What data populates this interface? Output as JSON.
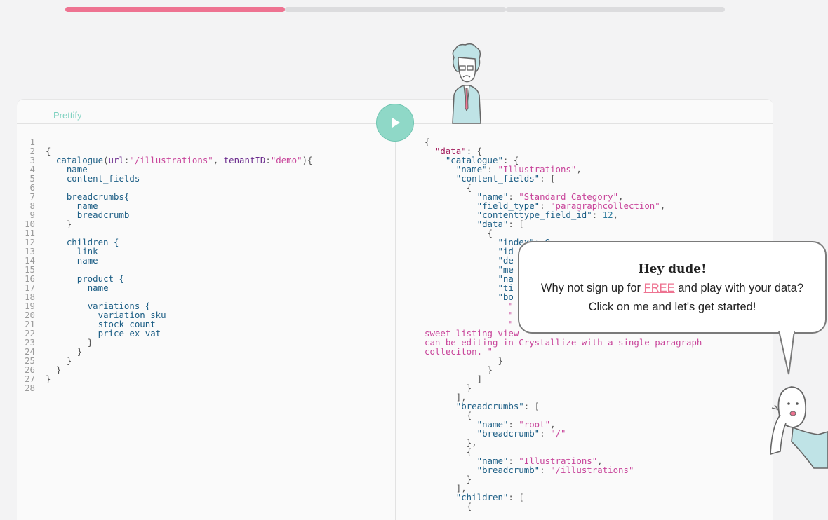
{
  "progress": {
    "value": 0.333,
    "segments": 3
  },
  "toolbar": {
    "prettify_label": "Prettify",
    "run_icon": "play-icon"
  },
  "editor": {
    "line_numbers": [
      "1",
      "2",
      "3",
      "4",
      "5",
      "6",
      "7",
      "8",
      "9",
      "10",
      "11",
      "12",
      "13",
      "14",
      "15",
      "16",
      "17",
      "18",
      "19",
      "20",
      "21",
      "22",
      "23",
      "24",
      "25",
      "26",
      "27",
      "28"
    ],
    "query": {
      "l2": "{",
      "l3_field": "catalogue",
      "l3_open": "(",
      "l3_arg1": "url",
      "l3_colon1": ":",
      "l3_val1": "\"/illustrations\"",
      "l3_comma": ", ",
      "l3_arg2": "tenantID",
      "l3_colon2": ":",
      "l3_val2": "\"demo\"",
      "l3_close": "){",
      "l4": "name",
      "l5": "content_fields",
      "l7": "breadcrumbs{",
      "l8": "name",
      "l9": "breadcrumb",
      "l10": "}",
      "l12": "children {",
      "l13": "link",
      "l14": "name",
      "l16": "product {",
      "l17": "name",
      "l19": "variations {",
      "l20": "variation_sku",
      "l21": "stock_count",
      "l22": "price_ex_vat",
      "l23": "}",
      "l24": "}",
      "l25": "}",
      "l26": "}",
      "l27": "}"
    }
  },
  "result": {
    "r1": "{",
    "r2_key": "\"data\"",
    "r2_rest": ": {",
    "r3_key": "\"catalogue\"",
    "r3_rest": ": {",
    "r4_key": "\"name\"",
    "r4_sep": ": ",
    "r4_val": "\"Illustrations\"",
    "r4_end": ",",
    "r5_key": "\"content_fields\"",
    "r5_rest": ": [",
    "r6": "{",
    "r7_key": "\"name\"",
    "r7_sep": ": ",
    "r7_val": "\"Standard Category\"",
    "r7_end": ",",
    "r8_key": "\"field_type\"",
    "r8_sep": ": ",
    "r8_val": "\"paragraphcollection\"",
    "r8_end": ",",
    "r9_key": "\"contenttype_field_id\"",
    "r9_sep": ": ",
    "r9_val": "12",
    "r9_end": ",",
    "r10_key": "\"data\"",
    "r10_rest": ": [",
    "r11": "{",
    "r12": "\"index\": 0",
    "r13": "\"id",
    "r14": "\"de",
    "r15": "\"me",
    "r16": "\"na",
    "r17": "\"ti",
    "r18": "\"bo",
    "r19": "\"",
    "r20": "\"",
    "r21": "\"",
    "r22": "sweet listing view",
    "r23": "can be editing in Crystallize with a single paragraph",
    "r24": "colleciton. \"",
    "r25": "}",
    "r26": "}",
    "r27": "]",
    "r28": "}",
    "r29": "],",
    "r30_key": "\"breadcrumbs\"",
    "r30_rest": ": [",
    "r31": "{",
    "r32_key": "\"name\"",
    "r32_sep": ": ",
    "r32_val": "\"root\"",
    "r32_end": ",",
    "r33_key": "\"breadcrumb\"",
    "r33_sep": ": ",
    "r33_val": "\"/\"",
    "r34": "},",
    "r35": "{",
    "r36_key": "\"name\"",
    "r36_sep": ": ",
    "r36_val": "\"Illustrations\"",
    "r36_end": ",",
    "r37_key": "\"breadcrumb\"",
    "r37_sep": ": ",
    "r37_val": "\"/illustrations\"",
    "r38": "}",
    "r39": "],",
    "r40_key": "\"children\"",
    "r40_rest": ": [",
    "r41": "{"
  },
  "cta": {
    "heading": "Hey dude!",
    "line1_before": "Why not sign up for ",
    "line1_link": "FREE",
    "line1_after": " and play with your data?",
    "line2": "Click on me and let's get started!"
  },
  "colors": {
    "accent": "#ee7391",
    "teal": "#8fd8c7",
    "string": "#c8449a",
    "key": "#a1185a",
    "field": "#1c5e85"
  }
}
